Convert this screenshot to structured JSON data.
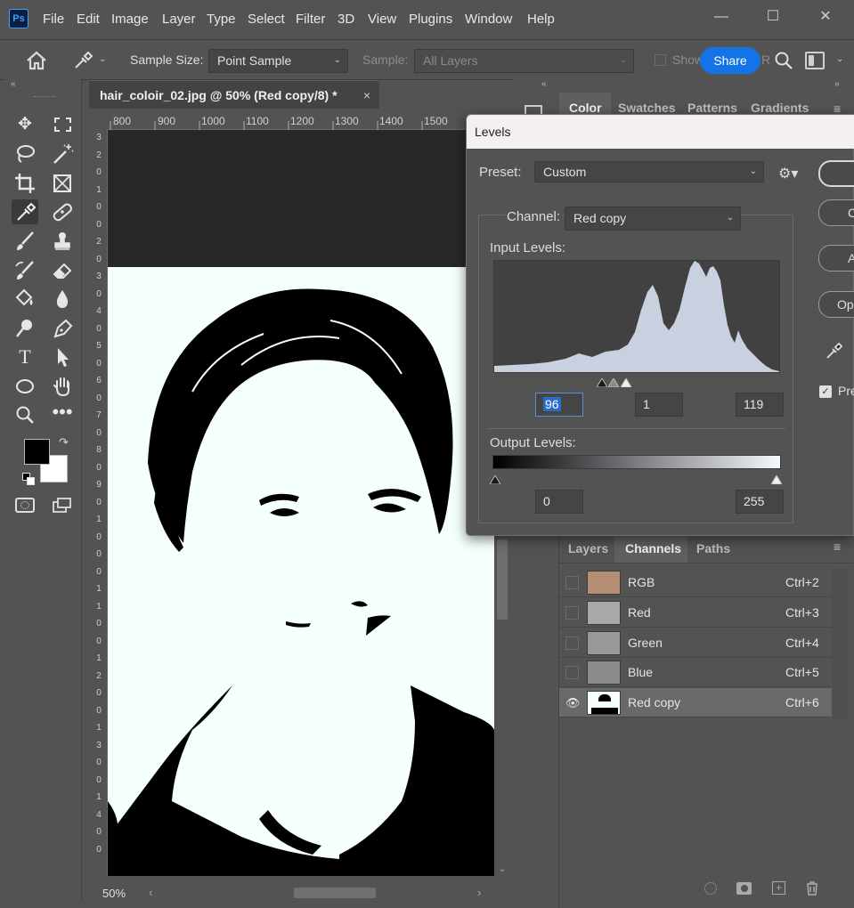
{
  "menu": [
    "File",
    "Edit",
    "Image",
    "Layer",
    "Type",
    "Select",
    "Filter",
    "3D",
    "View",
    "Plugins",
    "Window",
    "Help"
  ],
  "app_logo": "Ps",
  "options": {
    "sample_size_label": "Sample Size:",
    "sample_size_value": "Point Sample",
    "sample_label": "Sample:",
    "sample_value": "All Layers",
    "show_label": "Show",
    "share_label": "Share",
    "r_label": "R"
  },
  "document": {
    "tab_title": "hair_coloir_02.jpg @ 50% (Red copy/8) *",
    "close": "×",
    "zoom": "50%",
    "ruler_h": [
      "800",
      "900",
      "1000",
      "1100",
      "1200",
      "1300",
      "1400",
      "1500"
    ],
    "ruler_v": [
      "3",
      "2",
      "0",
      "1",
      "0",
      "0",
      "2",
      "0",
      "3",
      "0",
      "4",
      "0",
      "5",
      "0",
      "6",
      "0",
      "7",
      "0",
      "8",
      "0",
      "9",
      "0",
      "1",
      "0",
      "0",
      "0",
      "1",
      "1",
      "0",
      "0",
      "1",
      "2",
      "0",
      "0",
      "1",
      "3",
      "0",
      "0",
      "1",
      "4",
      "0",
      "0"
    ]
  },
  "right_panel": {
    "tabs": [
      "Color",
      "Swatches",
      "Patterns",
      "Gradients"
    ],
    "lower_tabs": [
      "Layers",
      "Channels",
      "Paths"
    ],
    "active_lower_tab": "Channels"
  },
  "channels": [
    {
      "name": "RGB",
      "shortcut": "Ctrl+2",
      "visible": false
    },
    {
      "name": "Red",
      "shortcut": "Ctrl+3",
      "visible": false
    },
    {
      "name": "Green",
      "shortcut": "Ctrl+4",
      "visible": false
    },
    {
      "name": "Blue",
      "shortcut": "Ctrl+5",
      "visible": false
    },
    {
      "name": "Red copy",
      "shortcut": "Ctrl+6",
      "visible": true
    }
  ],
  "levels": {
    "title": "Levels",
    "preset_label": "Preset:",
    "preset_value": "Custom",
    "channel_label": "Channel:",
    "channel_value": "Red copy",
    "input_levels_label": "Input Levels:",
    "input_black": "96",
    "input_gamma": "1",
    "input_white": "119",
    "output_levels_label": "Output Levels:",
    "output_black": "0",
    "output_white": "255",
    "buttons_partial": [
      "",
      "C",
      "A",
      "Op"
    ],
    "preview_label": "Pre",
    "preview_checked": true
  },
  "colors": {
    "accent": "#1473e6",
    "panel": "#535353",
    "dark": "#282828",
    "image_white": "#f5fffe"
  }
}
